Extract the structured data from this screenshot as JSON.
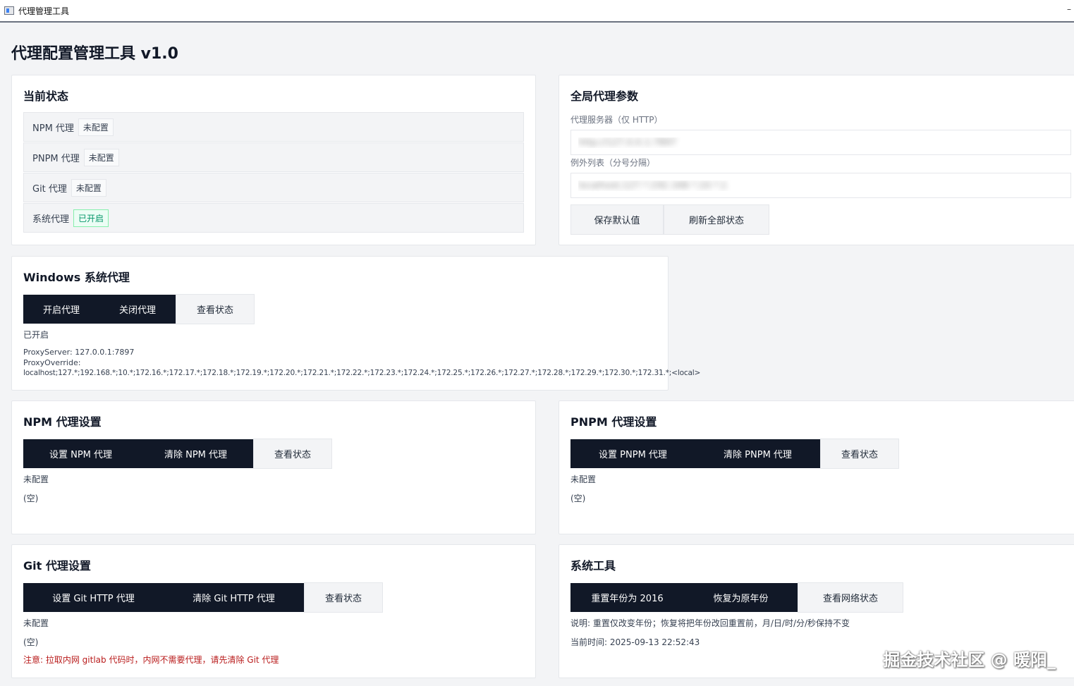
{
  "window": {
    "title": "代理管理工具",
    "minimize": "–"
  },
  "page": {
    "title": "代理配置管理工具 v1.0"
  },
  "status": {
    "title": "当前状态",
    "rows": [
      {
        "label": "NPM 代理",
        "value": "未配置"
      },
      {
        "label": "PNPM 代理",
        "value": "未配置"
      },
      {
        "label": "Git 代理",
        "value": "未配置"
      },
      {
        "label": "系统代理",
        "value": "已开启"
      }
    ]
  },
  "global": {
    "title": "全局代理参数",
    "server_label": "代理服务器（仅 HTTP）",
    "server_value": "http://127.0.0.1:7897",
    "except_label": "例外列表（分号分隔）",
    "except_value": "localhost;127.*;192.168.*;10.*;1",
    "save_label": "保存默认值",
    "refresh_label": "刷新全部状态"
  },
  "windows": {
    "title": "Windows 系统代理",
    "enable_label": "开启代理",
    "disable_label": "关闭代理",
    "view_label": "查看状态",
    "state": "已开启",
    "line1": "ProxyServer: 127.0.0.1:7897",
    "line2": "ProxyOverride:",
    "line3": "localhost;127.*;192.168.*;10.*;172.16.*;172.17.*;172.18.*;172.19.*;172.20.*;172.21.*;172.22.*;172.23.*;172.24.*;172.25.*;172.26.*;172.27.*;172.28.*;172.29.*;172.30.*;172.31.*;<local>"
  },
  "npm": {
    "title": "NPM 代理设置",
    "set_label": "设置 NPM 代理",
    "clear_label": "清除 NPM 代理",
    "view_label": "查看状态",
    "state": "未配置",
    "detail": "(空)"
  },
  "pnpm": {
    "title": "PNPM 代理设置",
    "set_label": "设置 PNPM 代理",
    "clear_label": "清除 PNPM 代理",
    "view_label": "查看状态",
    "state": "未配置",
    "detail": "(空)"
  },
  "git": {
    "title": "Git 代理设置",
    "set_label": "设置 Git HTTP 代理",
    "clear_label": "清除 Git HTTP 代理",
    "view_label": "查看状态",
    "state": "未配置",
    "detail": "(空)",
    "note": "注意: 拉取内网 gitlab 代码时，内网不需要代理，请先清除 Git 代理"
  },
  "tools": {
    "title": "系统工具",
    "reset_label": "重置年份为 2016",
    "restore_label": "恢复为原年份",
    "net_label": "查看网络状态",
    "desc": "说明: 重置仅改变年份；恢复将把年份改回重置前，月/日/时/分/秒保持不变",
    "time": "当前时间: 2025-09-13 22:52:43"
  },
  "watermark": "掘金技术社区 @ 暖阳_"
}
